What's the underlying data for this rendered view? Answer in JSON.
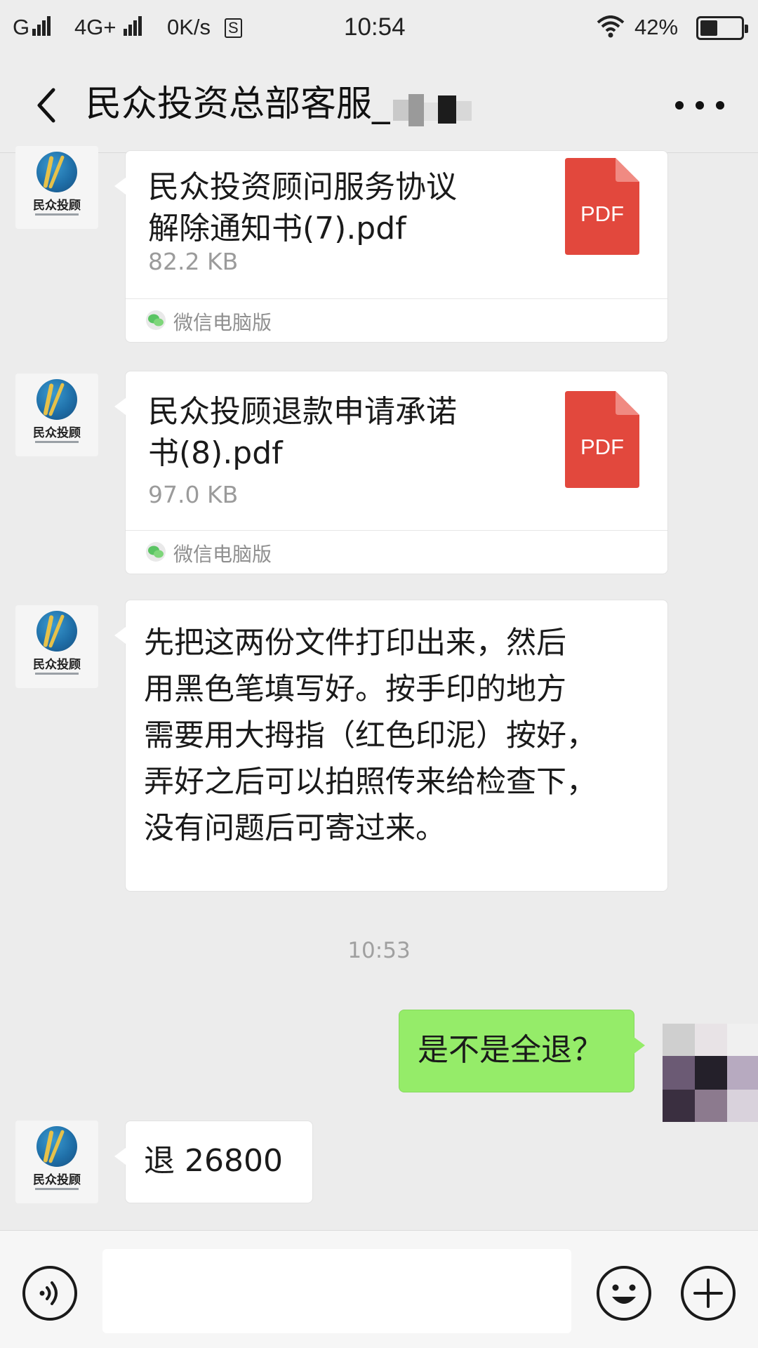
{
  "status_bar": {
    "carrier1": "G",
    "carrier2": "4G+",
    "net_speed": "0K/s",
    "s_badge": "S",
    "time": "10:54",
    "battery": "42%",
    "battery_level": 0.42
  },
  "header": {
    "title": "民众投资总部客服_",
    "back_icon": "chevron-left-icon",
    "more_icon": "more-dots-icon"
  },
  "messages": [
    {
      "type": "file",
      "sender": "contact",
      "avatar_label": "民众投顾",
      "file_name": "民众投资顾问服务协议解除通知书(7).pdf",
      "file_name_line1": "民众投资顾问服务协议",
      "file_name_line2": "解除通知书(7).pdf",
      "file_size": "82.2 KB",
      "file_icon_label": "PDF",
      "footer": "微信电脑版"
    },
    {
      "type": "file",
      "sender": "contact",
      "avatar_label": "民众投顾",
      "file_name": "民众投顾退款申请承诺书(8).pdf",
      "file_name_line1": "民众投顾退款申请承诺",
      "file_name_line2": "书(8).pdf",
      "file_size": "97.0 KB",
      "file_icon_label": "PDF",
      "footer": "微信电脑版"
    },
    {
      "type": "text",
      "sender": "contact",
      "avatar_label": "民众投顾",
      "lines": [
        "先把这两份文件打印出来，然后",
        "用黑色笔填写好。按手印的地方",
        "需要用大拇指（红色印泥）按好，",
        "弄好之后可以拍照传来给检查下，",
        "没有问题后可寄过来。"
      ]
    },
    {
      "type": "time",
      "text": "10:53"
    },
    {
      "type": "text",
      "sender": "me",
      "text": "是不是全退？"
    },
    {
      "type": "text",
      "sender": "contact",
      "avatar_label": "民众投顾",
      "text": "退 26800"
    }
  ],
  "input_bar": {
    "voice_icon": "voice-icon",
    "emoji_icon": "emoji-icon",
    "plus_icon": "plus-icon",
    "value": ""
  },
  "colors": {
    "background": "#ececec",
    "my_bubble": "#95ec69",
    "their_bubble": "#ffffff",
    "pdf_red": "#e2483d"
  }
}
